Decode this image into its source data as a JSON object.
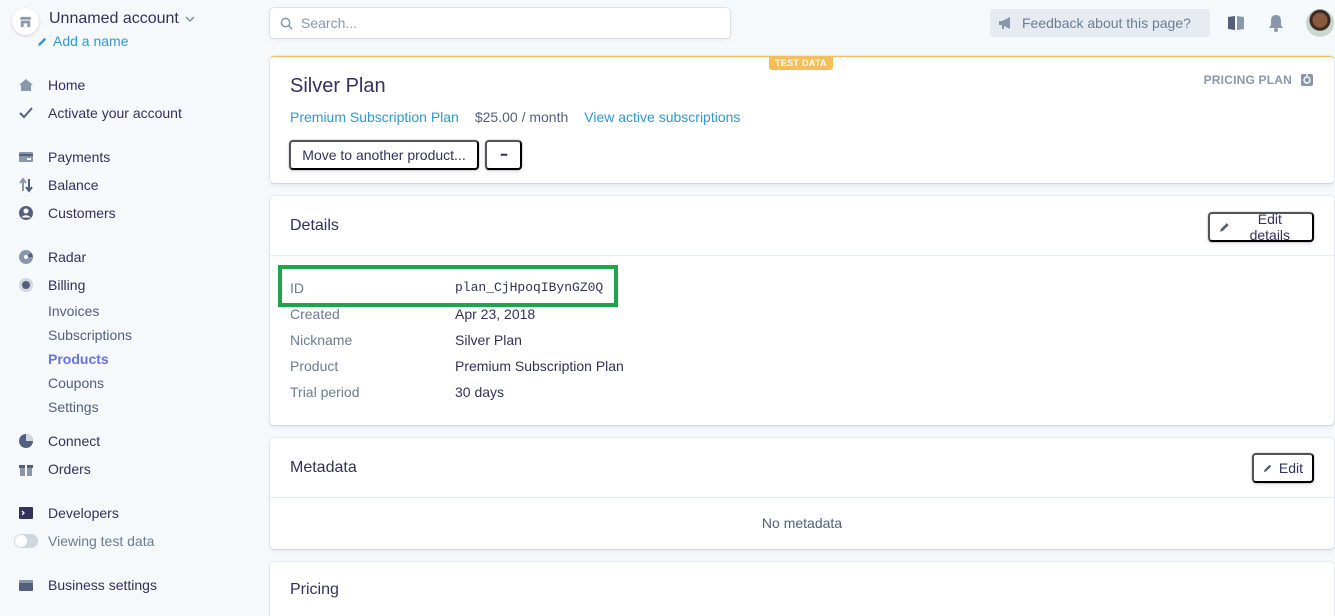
{
  "sidebar": {
    "account_name": "Unnamed account",
    "add_name": "Add a name",
    "items": {
      "home": "Home",
      "activate": "Activate your account",
      "payments": "Payments",
      "balance": "Balance",
      "customers": "Customers",
      "radar": "Radar",
      "billing": "Billing",
      "invoices": "Invoices",
      "subscriptions": "Subscriptions",
      "products": "Products",
      "coupons": "Coupons",
      "settings": "Settings",
      "connect": "Connect",
      "orders": "Orders",
      "developers": "Developers",
      "viewing_test_data": "Viewing test data",
      "business_settings": "Business settings"
    }
  },
  "topbar": {
    "search_placeholder": "Search...",
    "feedback": "Feedback about this page?"
  },
  "plan": {
    "test_badge": "TEST DATA",
    "title": "Silver Plan",
    "type_label": "PRICING PLAN",
    "product_link": "Premium Subscription Plan",
    "price": "$25.00 / month",
    "view_subs": "View active subscriptions",
    "move_btn": "Move to another product...",
    "more_btn": "•••"
  },
  "details": {
    "title": "Details",
    "edit_btn": "Edit details",
    "rows": [
      {
        "k": "ID",
        "v": "plan_CjHpoqIBynGZ0Q"
      },
      {
        "k": "Created",
        "v": "Apr 23, 2018"
      },
      {
        "k": "Nickname",
        "v": "Silver Plan"
      },
      {
        "k": "Product",
        "v": "Premium Subscription Plan"
      },
      {
        "k": "Trial period",
        "v": "30 days"
      }
    ]
  },
  "metadata": {
    "title": "Metadata",
    "edit_btn": "Edit",
    "empty": "No metadata"
  },
  "pricing": {
    "title": "Pricing"
  },
  "colors": {
    "accent": "#6772e5",
    "link": "#3297d3",
    "test": "#f5be58",
    "highlight": "#1ea54b"
  }
}
